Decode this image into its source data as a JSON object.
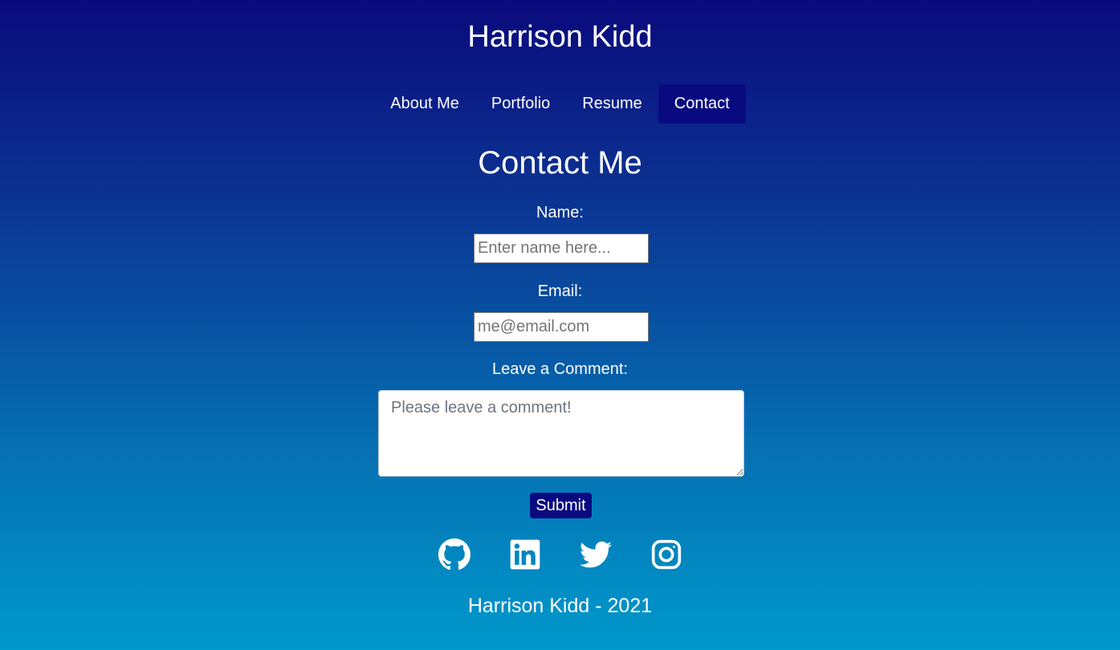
{
  "header": {
    "title": "Harrison Kidd"
  },
  "nav": {
    "items": [
      {
        "label": "About Me"
      },
      {
        "label": "Portfolio"
      },
      {
        "label": "Resume"
      },
      {
        "label": "Contact"
      }
    ],
    "active": "Contact"
  },
  "contact": {
    "heading": "Contact Me",
    "name_label": "Name:",
    "name_placeholder": "Enter name here...",
    "email_label": "Email:",
    "email_placeholder": "me@email.com",
    "comment_label": "Leave a Comment:",
    "comment_placeholder": "Please leave a comment!",
    "submit_label": "Submit"
  },
  "social": {
    "icons": [
      "github-icon",
      "linkedin-icon",
      "twitter-icon",
      "instagram-icon"
    ]
  },
  "footer": {
    "text": "Harrison Kidd - 2021"
  },
  "colors": {
    "gradient_top": "#0a0a7c",
    "gradient_bottom": "#0099cc",
    "accent": "#0a0a80"
  }
}
